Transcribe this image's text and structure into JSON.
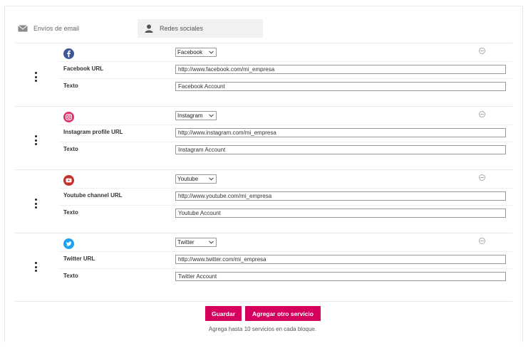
{
  "tabs": {
    "email": {
      "label": "Envíos de email",
      "icon": "envelope-icon"
    },
    "social": {
      "label": "Redes sociales",
      "icon": "user-icon"
    }
  },
  "services": [
    {
      "service": "Facebook",
      "icon": "facebook-icon",
      "color": "#3b5998",
      "url_label": "Facebook URL",
      "url_value": "http://www.facebook.com/mi_empresa",
      "text_label": "Texto",
      "text_value": "Facebook Account"
    },
    {
      "service": "Instagram",
      "icon": "instagram-icon",
      "color": "#e1306c",
      "url_label": "Instagram profile URL",
      "url_value": "http://www.instagram.com/mi_empresa",
      "text_label": "Texto",
      "text_value": "Instagram Account"
    },
    {
      "service": "Youtube",
      "icon": "youtube-icon",
      "color": "#c4302b",
      "url_label": "Youtube channel URL",
      "url_value": "http://www.youtube.com/mi_empresa",
      "text_label": "Texto",
      "text_value": "Youtube Account"
    },
    {
      "service": "Twitter",
      "icon": "twitter-icon",
      "color": "#1da1f2",
      "url_label": "Twitter URL",
      "url_value": "http://www.twitter.com/mi_empresa",
      "text_label": "Texto",
      "text_value": "Twitter Account"
    }
  ],
  "actions": {
    "save_label": "Guardar",
    "add_label": "Agregar otro servicio",
    "hint": "Agrega hasta 10 servicios en cada bloque.",
    "accent": "#d6005d"
  }
}
